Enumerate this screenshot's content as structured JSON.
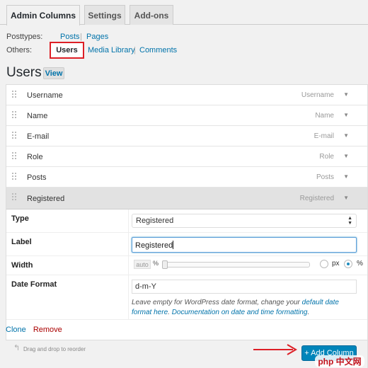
{
  "tabs": [
    "Admin Columns",
    "Settings",
    "Add-ons"
  ],
  "posttypes": {
    "label": "Posttypes:",
    "items": [
      "Posts",
      "Pages"
    ]
  },
  "others": {
    "label": "Others:",
    "current": "Users",
    "items": [
      "Media Library",
      "Comments"
    ]
  },
  "heading": {
    "title": "Users",
    "view": "View"
  },
  "columns": [
    {
      "name": "Username",
      "type": "Username"
    },
    {
      "name": "Name",
      "type": "Name"
    },
    {
      "name": "E-mail",
      "type": "E-mail"
    },
    {
      "name": "Role",
      "type": "Role"
    },
    {
      "name": "Posts",
      "type": "Posts"
    },
    {
      "name": "Registered",
      "type": "Registered"
    }
  ],
  "settings": {
    "type_label": "Type",
    "type_value": "Registered",
    "label_label": "Label",
    "label_value": "Registered",
    "width_label": "Width",
    "width_auto": "auto",
    "width_percent_sign": "%",
    "width_unit_px": "px",
    "width_unit_pct": "%",
    "date_label": "Date Format",
    "date_value": "d-m-Y",
    "hint_text1": "Leave empty for WordPress date format, change your ",
    "hint_link1": "default date format here",
    "hint_text2": ". ",
    "hint_link2": "Documentation on date and time formatting",
    "hint_text3": "."
  },
  "actions": {
    "clone": "Clone",
    "remove": "Remove"
  },
  "footer": {
    "drag_note": "Drag and drop to reorder",
    "add_column": "+ Add Column"
  },
  "watermark": "php 中文网",
  "colors": {
    "accent": "#0073aa",
    "button": "#0085ba",
    "highlight": "#dd1f26"
  }
}
